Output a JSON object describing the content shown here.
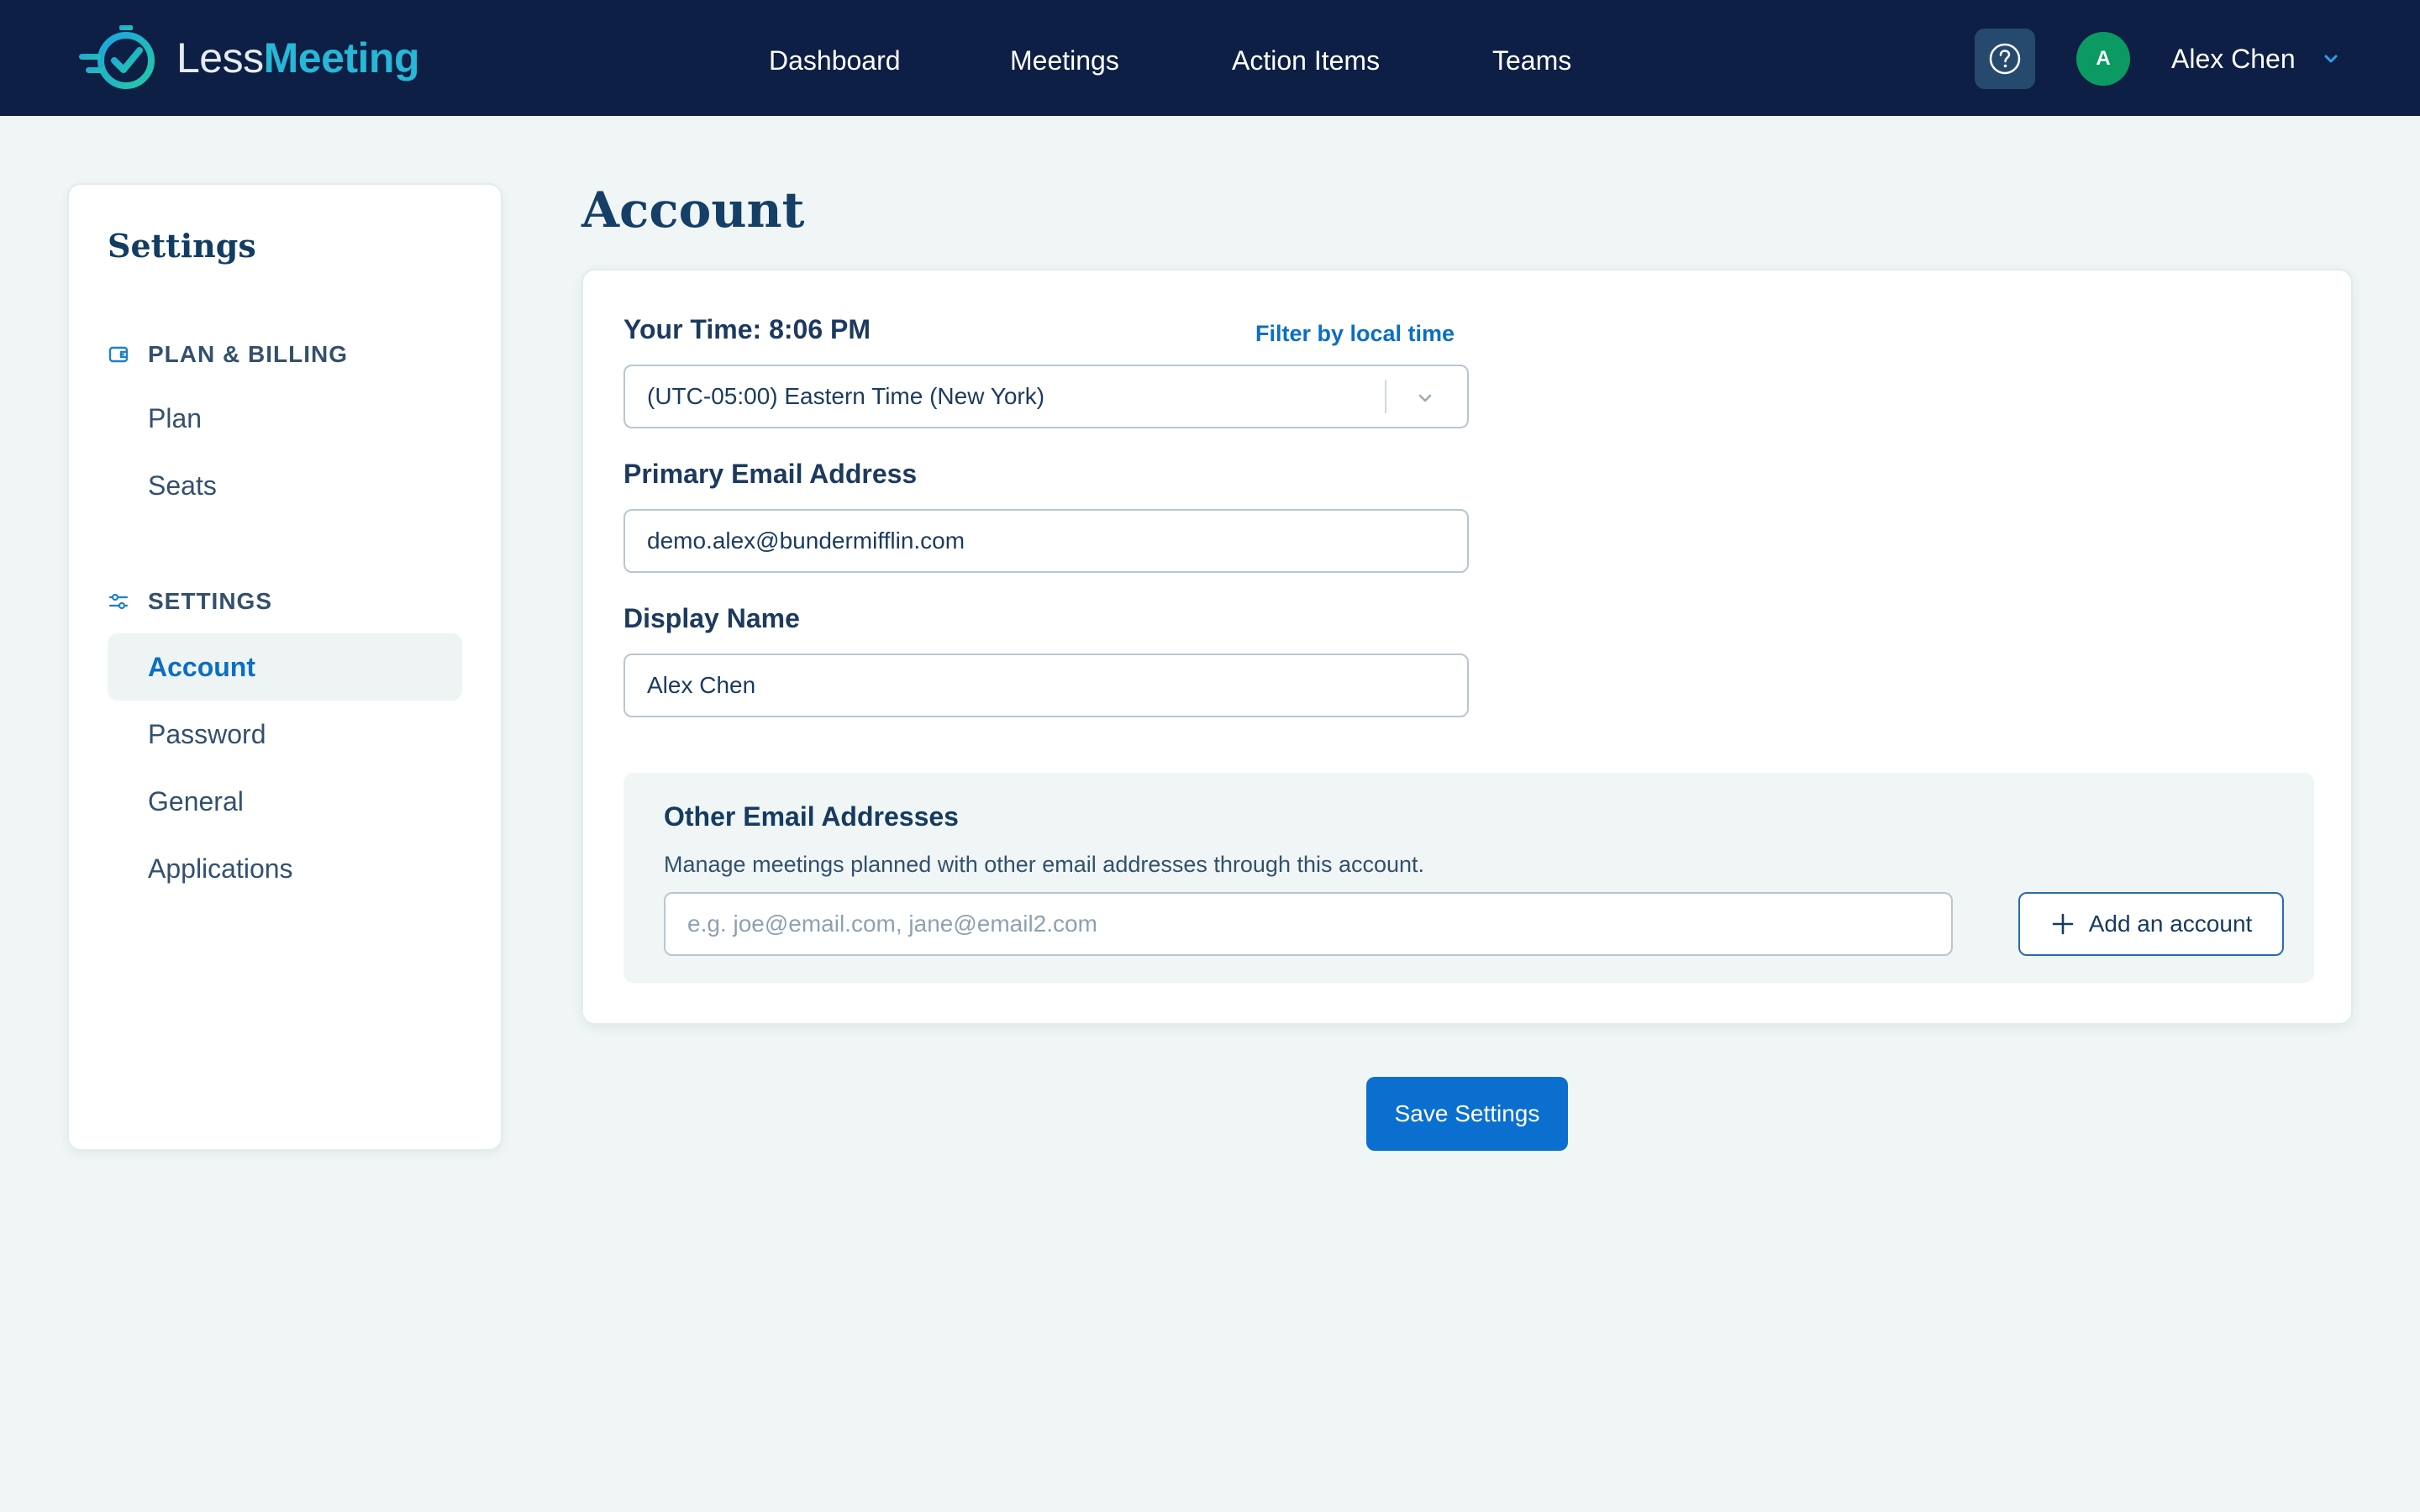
{
  "brand": {
    "name_part1": "Less",
    "name_part2": "Meeting"
  },
  "nav": {
    "links": [
      "Dashboard",
      "Meetings",
      "Action Items",
      "Teams"
    ],
    "avatar_initial": "A",
    "user_name": "Alex Chen"
  },
  "sidebar": {
    "title": "Settings",
    "sections": [
      {
        "heading": "PLAN & BILLING",
        "items": [
          "Plan",
          "Seats"
        ]
      },
      {
        "heading": "SETTINGS",
        "items": [
          "Account",
          "Password",
          "General",
          "Applications"
        ]
      }
    ],
    "active_item": "Account"
  },
  "page": {
    "title": "Account"
  },
  "account_form": {
    "time_label": "Your Time: 8:06 PM",
    "filter_link": "Filter by local time",
    "timezone_value": "(UTC-05:00) Eastern Time (New York)",
    "email_label": "Primary Email Address",
    "email_value": "demo.alex@bundermifflin.com",
    "display_name_label": "Display Name",
    "display_name_value": "Alex Chen"
  },
  "other_emails": {
    "title": "Other Email Addresses",
    "description": "Manage meetings planned with other email addresses through this account.",
    "placeholder": "e.g. joe@email.com, jane@email2.com",
    "add_button": "Add an account"
  },
  "save_button": "Save Settings",
  "colors": {
    "nav_bg": "#0d1f44",
    "page_bg": "#eff6f5",
    "accent": "#0b6fd0",
    "brand_teal": "#28b7d6",
    "avatar": "#0b9a62"
  }
}
